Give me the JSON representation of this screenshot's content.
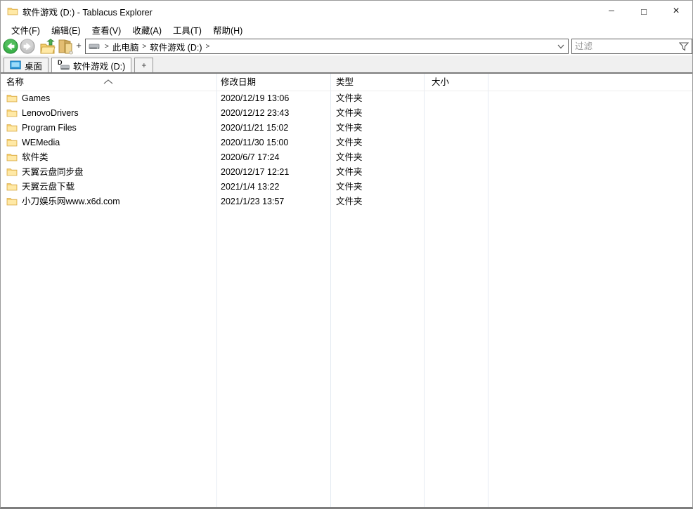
{
  "window": {
    "title": "软件游戏 (D:) - Tablacus Explorer",
    "controls": {
      "minimize": "─",
      "maximize": "□",
      "close": "×"
    }
  },
  "menu": {
    "items": [
      "文件(F)",
      "编辑(E)",
      "查看(V)",
      "收藏(A)",
      "工具(T)",
      "帮助(H)"
    ]
  },
  "toolbar": {
    "plus_label": "+",
    "address": {
      "sep": ">",
      "crumbs": [
        "此电脑",
        "软件游戏 (D:)"
      ]
    },
    "filter_placeholder": "过滤"
  },
  "tabbar": {
    "tabs": [
      {
        "label": "桌面"
      },
      {
        "label": "软件游戏 (D:)",
        "badge": "D"
      }
    ],
    "new_tab_label": "+"
  },
  "filelist": {
    "columns": [
      "名称",
      "修改日期",
      "类型",
      "大小"
    ],
    "rows": [
      {
        "name": "Games",
        "date": "2020/12/19 13:06",
        "type": "文件夹",
        "size": ""
      },
      {
        "name": "LenovoDrivers",
        "date": "2020/12/12 23:43",
        "type": "文件夹",
        "size": ""
      },
      {
        "name": "Program Files",
        "date": "2020/11/21 15:02",
        "type": "文件夹",
        "size": ""
      },
      {
        "name": "WEMedia",
        "date": "2020/11/30 15:00",
        "type": "文件夹",
        "size": ""
      },
      {
        "name": "软件类",
        "date": "2020/6/7 17:24",
        "type": "文件夹",
        "size": ""
      },
      {
        "name": "天翼云盘同步盘",
        "date": "2020/12/17 12:21",
        "type": "文件夹",
        "size": ""
      },
      {
        "name": "天翼云盘下载",
        "date": "2021/1/4 13:22",
        "type": "文件夹",
        "size": ""
      },
      {
        "name": "小刀娱乐网www.x6d.com",
        "date": "2021/1/23 13:57",
        "type": "文件夹",
        "size": ""
      }
    ]
  },
  "colors": {
    "folder_yellow": "#ffe096",
    "folder_edge": "#d9ad4f",
    "back_green": "#3cb24a",
    "forward_gray": "#c6c6c6",
    "tabbar_bg": "#f0f0f0",
    "tab_separator": "#7b7b7b",
    "column_line": "#e4eaf2"
  }
}
